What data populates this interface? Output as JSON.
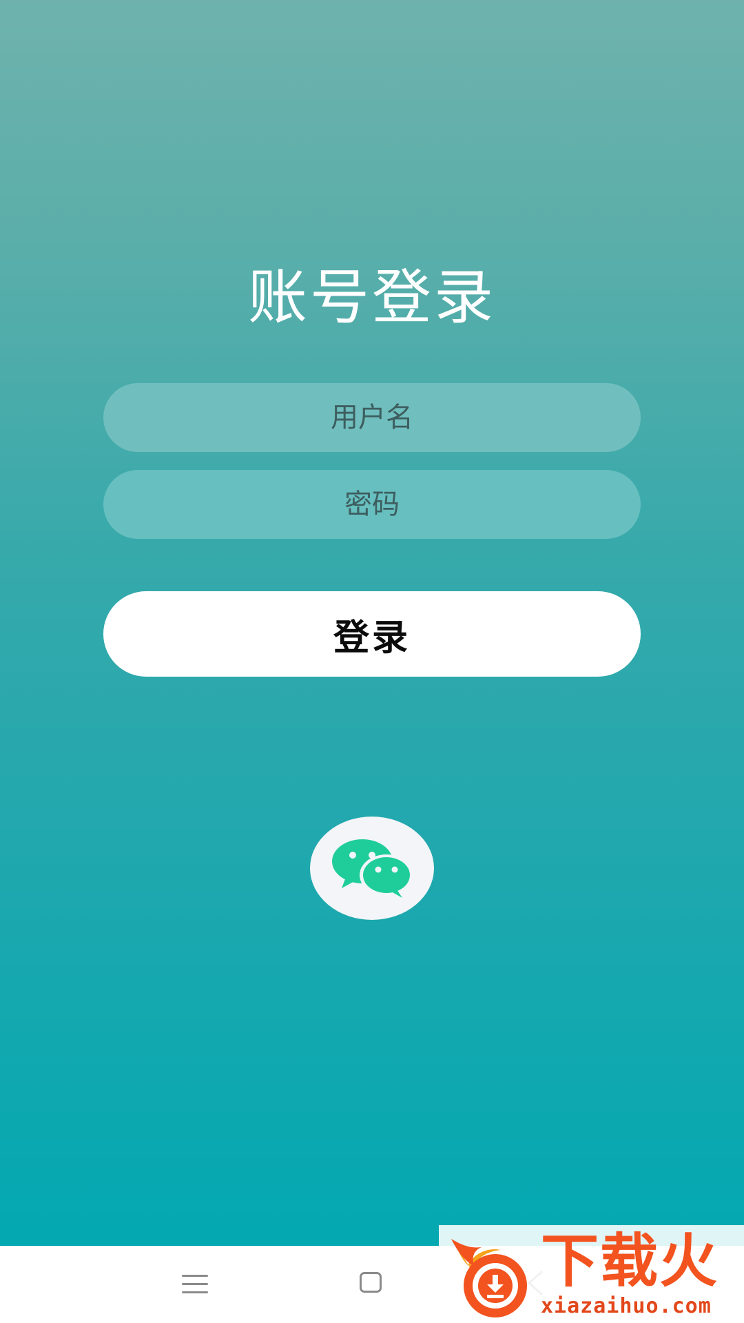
{
  "login": {
    "title": "账号登录",
    "username_placeholder": "用户名",
    "password_placeholder": "密码",
    "login_label": "登录",
    "wechat_icon": "wechat-icon"
  },
  "nav": {
    "menu_icon": "menu-icon",
    "home_icon": "home-icon",
    "back_icon": "back-icon"
  },
  "watermark": {
    "title": "下载火",
    "url": "xiazaihuo.com"
  },
  "colors": {
    "gradient_top": "#6fb2ad",
    "gradient_bottom": "#03a8b1",
    "wechat_green": "#1fcd9b",
    "watermark_orange": "#f2531f"
  }
}
